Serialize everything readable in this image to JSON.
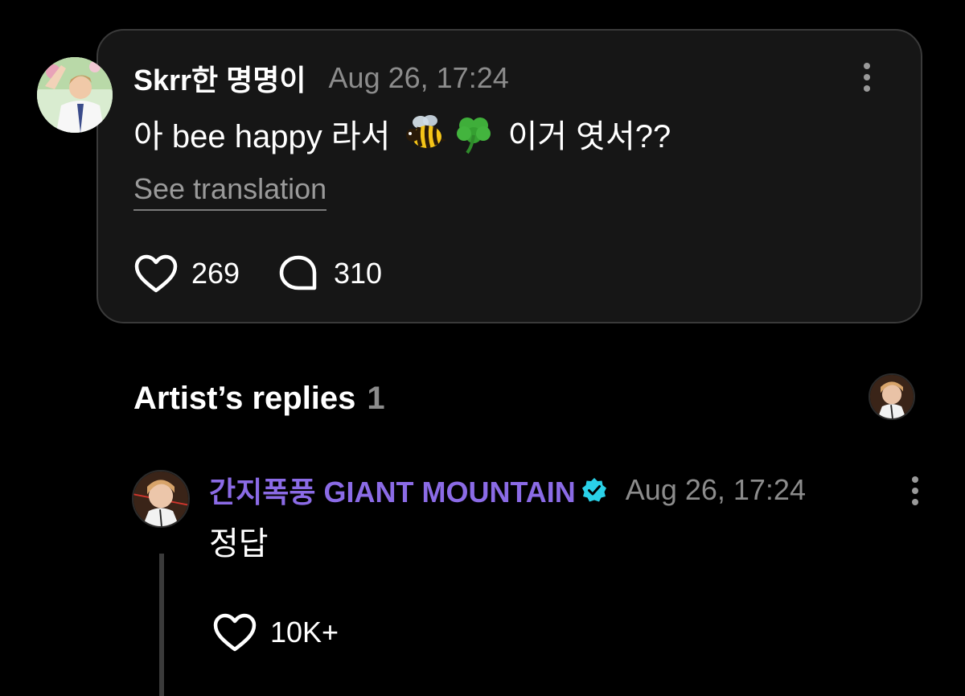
{
  "comment": {
    "author": "Skrr한 명명이",
    "timestamp": "Aug 26, 17:24",
    "text_before": "아 bee happy 라서",
    "emojis": [
      "bee-emoji",
      "clover-emoji"
    ],
    "text_after": "이거 엿서??",
    "see_translation": "See translation",
    "likes": "269",
    "replies": "310"
  },
  "artist_replies": {
    "heading": "Artist’s replies",
    "count": "1",
    "reply": {
      "author": "간지폭풍 GIANT MOUNTAIN",
      "verified": true,
      "timestamp": "Aug 26, 17:24",
      "text": "정답",
      "likes": "10K+"
    }
  },
  "colors": {
    "background": "#000000",
    "card_background": "#161616",
    "card_border": "#3a3a3a",
    "muted_text": "#8c8c8c",
    "artist_name": "#8b6be6",
    "verified_badge": "#2ad1e8"
  },
  "icons": [
    "more-vertical-icon",
    "heart-icon",
    "comment-bubble-icon",
    "verified-badge-icon"
  ]
}
